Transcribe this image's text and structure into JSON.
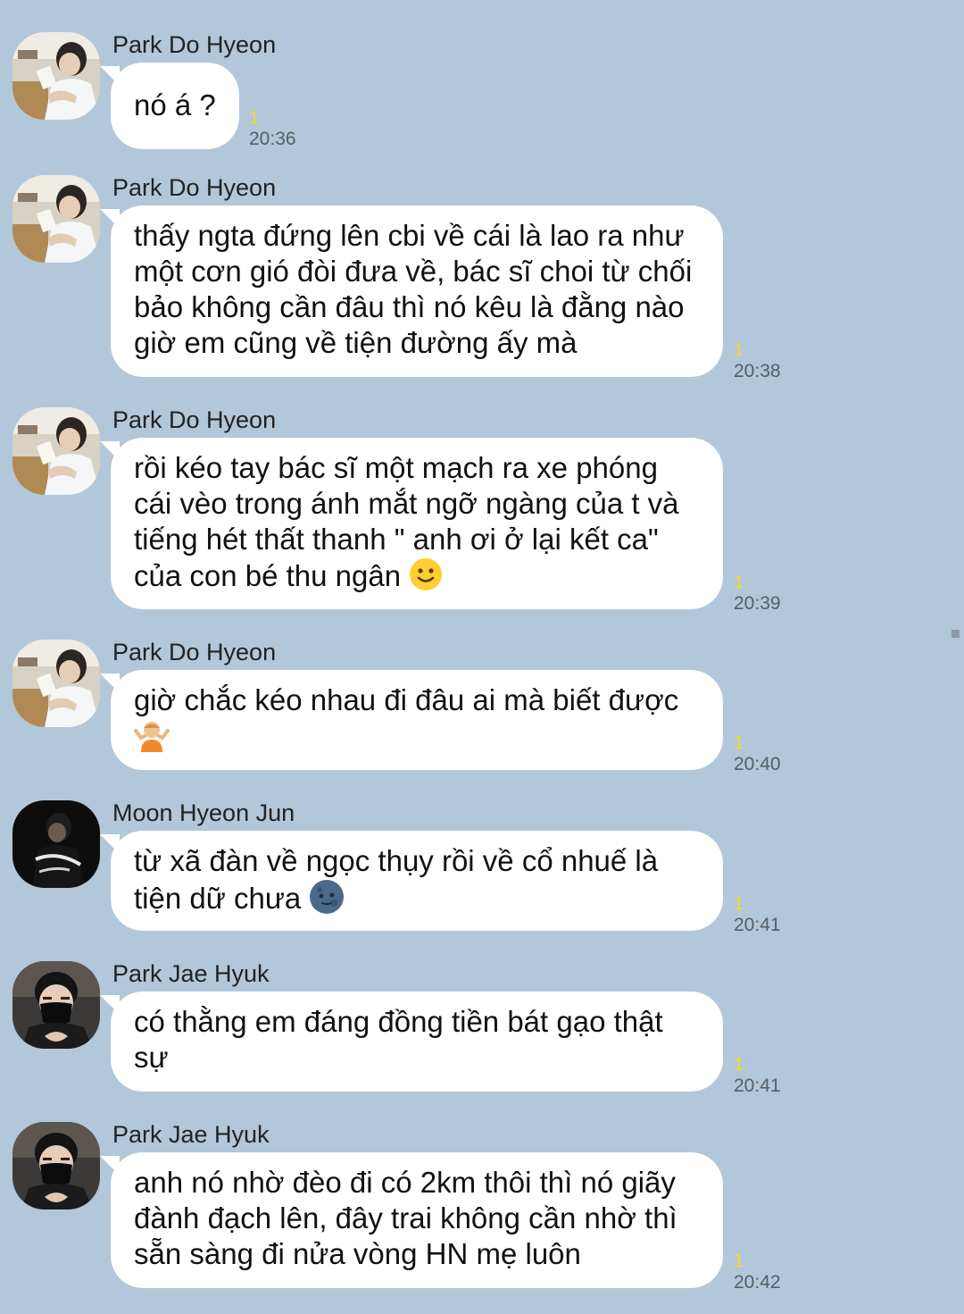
{
  "colors": {
    "background": "#b2c7da",
    "bubble": "#ffffff",
    "unread_count": "#f2dd22",
    "timestamp": "#555e66"
  },
  "messages": [
    {
      "sender": "Park Do Hyeon",
      "avatar": "avatar-park-do-hyeon",
      "lines": [
        "nó á ?"
      ],
      "unread": "1",
      "time": "20:36"
    },
    {
      "sender": "Park Do Hyeon",
      "avatar": "avatar-park-do-hyeon",
      "lines": [
        "thấy ngta đứng lên cbi về cái là lao ra như",
        "một cơn gió đòi đưa về, bác sĩ choi từ chối",
        "bảo không cần đâu thì nó kêu là đằng nào",
        "giờ em cũng về tiện đường ấy mà"
      ],
      "unread": "1",
      "time": "20:38"
    },
    {
      "sender": "Park Do Hyeon",
      "avatar": "avatar-park-do-hyeon",
      "lines": [
        "rồi kéo tay bác sĩ một mạch ra xe phóng",
        "cái vèo trong ánh mắt ngỡ ngàng của t và",
        "tiếng hét thất thanh \" anh ơi ở lại kết ca\"",
        "của con bé thu ngân"
      ],
      "emoji": "slightly-smiling-face-icon",
      "unread": "1",
      "time": "20:39"
    },
    {
      "sender": "Park Do Hyeon",
      "avatar": "avatar-park-do-hyeon",
      "lines": [
        "giờ chắc kéo nhau đi đâu ai mà biết được"
      ],
      "emoji": "person-shrugging-icon",
      "unread": "1",
      "time": "20:40"
    },
    {
      "sender": "Moon Hyeon Jun",
      "avatar": "avatar-moon-hyeon-jun",
      "lines": [
        "từ xã đàn về ngọc thụy rồi về cổ nhuế là",
        "tiện dữ chưa"
      ],
      "emoji": "new-moon-face-icon",
      "unread": "1",
      "time": "20:41"
    },
    {
      "sender": "Park Jae Hyuk",
      "avatar": "avatar-park-jae-hyuk",
      "lines": [
        "có thằng em đáng đồng tiền bát gạo thật",
        "sự"
      ],
      "unread": "1",
      "time": "20:41"
    },
    {
      "sender": "Park Jae Hyuk",
      "avatar": "avatar-park-jae-hyuk",
      "lines": [
        "anh nó nhờ đèo đi có 2km thôi thì nó giãy",
        "đành đạch lên, đây trai không cần nhờ thì",
        "sẵn sàng đi nửa vòng HN mẹ luôn"
      ],
      "unread": "1",
      "time": "20:42"
    }
  ]
}
